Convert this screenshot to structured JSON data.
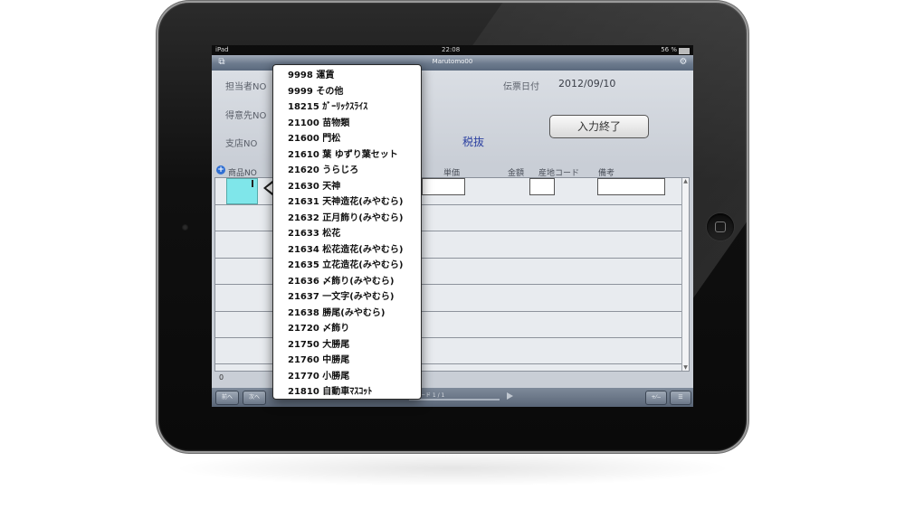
{
  "status_bar": {
    "carrier": "iPad",
    "time": "22:08",
    "battery": "56 %"
  },
  "nav": {
    "title": "Marutomo00",
    "left_icon": "copy-icon",
    "right_icon": "gear-icon"
  },
  "form": {
    "staff_no_label": "担当者NO",
    "customer_no_label": "得意先NO",
    "branch_no_label": "支店NO",
    "slip_date_label": "伝票日付",
    "slip_date_value": "2012/09/10",
    "tax_mode": "税抜",
    "finish_button": "入力終了"
  },
  "table": {
    "headers": {
      "product_no": "商品NO",
      "unit_price": "単価",
      "amount": "金額",
      "origin_code": "産地コード",
      "note": "備考"
    },
    "row_count": "0"
  },
  "toolbar": {
    "prev": "前へ",
    "next": "次へ",
    "record": "レコード 1 / 1"
  },
  "popover_items": [
    "9998 運賃",
    "9999 その他",
    "18215 ｶﾞｰﾘｯｸｽﾗｲｽ",
    "21100 苗物類",
    "21600 門松",
    "21610 葉 ゆずり葉セット",
    "21620 うらじろ",
    "21630 天神",
    "21631 天神造花(みやむら)",
    "21632 正月飾り(みやむら)",
    "21633 松花",
    "21634 松花造花(みやむら)",
    "21635 立花造花(みやむら)",
    "21636 〆飾り(みやむら)",
    "21637 一文字(みやむら)",
    "21638 勝尾(みやむら)",
    "21720 〆飾り",
    "21750 大勝尾",
    "21760 中勝尾",
    "21770 小勝尾",
    "21810 自動車ﾏｽｺｯﾄ"
  ]
}
